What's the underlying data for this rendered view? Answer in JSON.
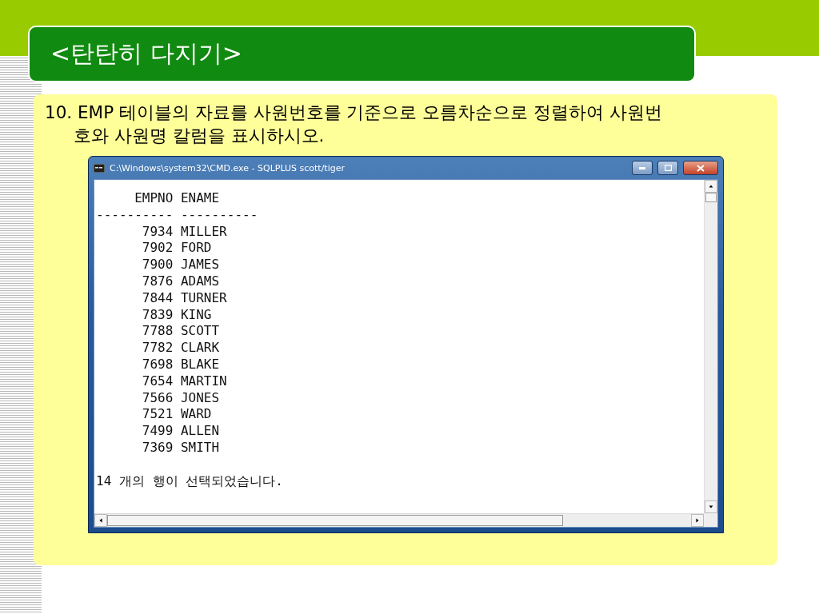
{
  "slide": {
    "title": "<탄탄히 다지기>",
    "question": "10. EMP 테이블의 자료를 사원번호를 기준으로 오름차순으로 정렬하여 사원번호와 사원명 칼럼을 표시하시오.",
    "console_window": {
      "title": "C:\\Windows\\system32\\CMD.exe - SQLPLUS  scott/tiger",
      "columns": [
        "EMPNO",
        "ENAME"
      ],
      "separator": "---------- ----------",
      "rows": [
        {
          "empno": "7934",
          "ename": "MILLER"
        },
        {
          "empno": "7902",
          "ename": "FORD"
        },
        {
          "empno": "7900",
          "ename": "JAMES"
        },
        {
          "empno": "7876",
          "ename": "ADAMS"
        },
        {
          "empno": "7844",
          "ename": "TURNER"
        },
        {
          "empno": "7839",
          "ename": "KING"
        },
        {
          "empno": "7788",
          "ename": "SCOTT"
        },
        {
          "empno": "7782",
          "ename": "CLARK"
        },
        {
          "empno": "7698",
          "ename": "BLAKE"
        },
        {
          "empno": "7654",
          "ename": "MARTIN"
        },
        {
          "empno": "7566",
          "ename": "JONES"
        },
        {
          "empno": "7521",
          "ename": "WARD"
        },
        {
          "empno": "7499",
          "ename": "ALLEN"
        },
        {
          "empno": "7369",
          "ename": "SMITH"
        }
      ],
      "message": "14 개의 행이 선택되었습니다."
    }
  }
}
